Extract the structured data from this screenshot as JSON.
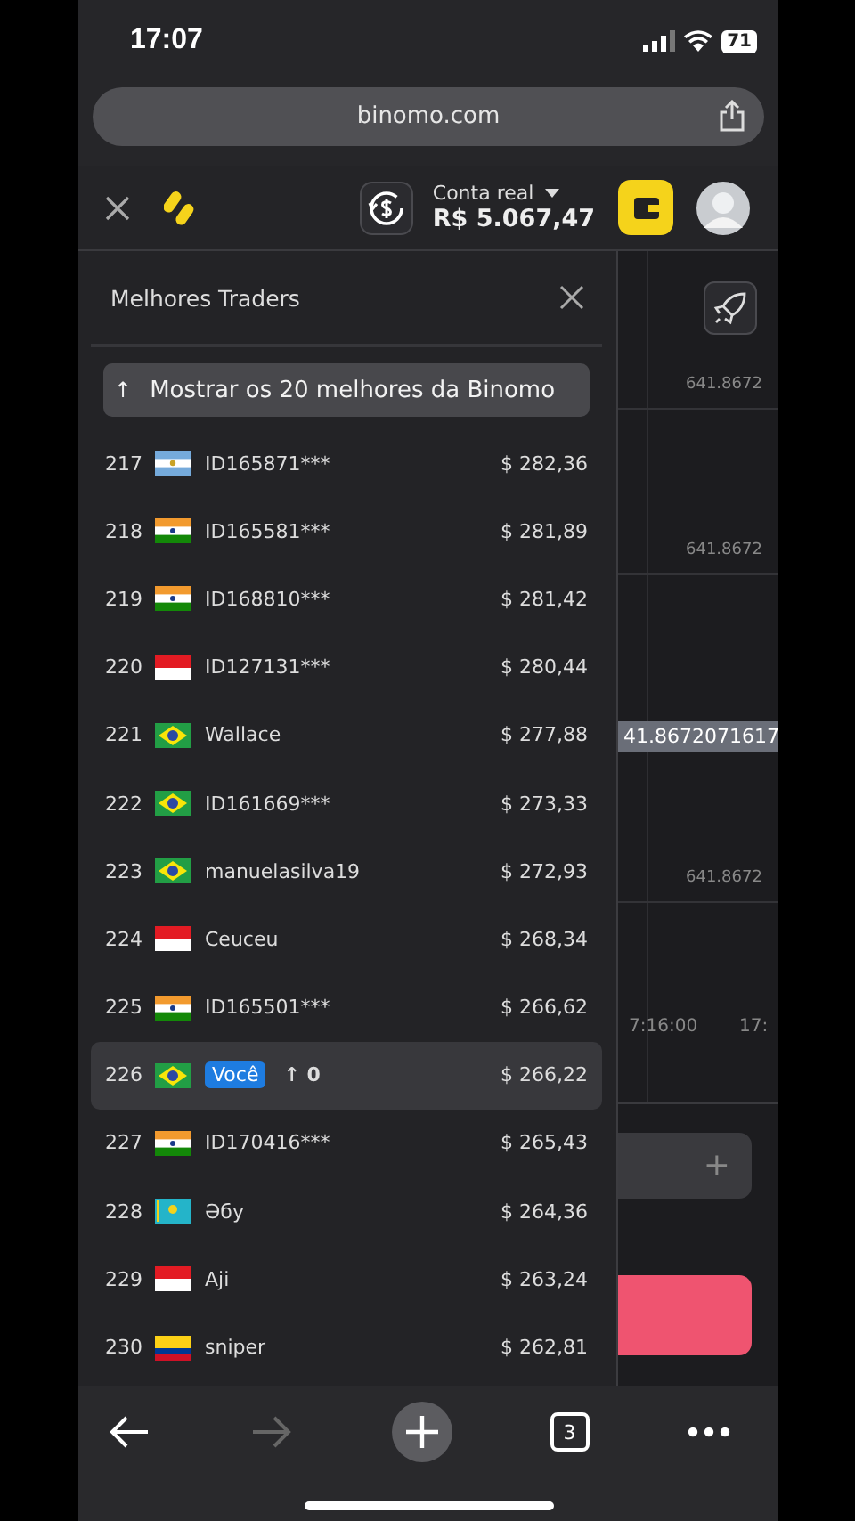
{
  "status_bar": {
    "time": "17:07",
    "battery": "71"
  },
  "browser": {
    "url": "binomo.com",
    "tab_count": "3",
    "forward_disabled": true
  },
  "header": {
    "account_label": "Conta real",
    "balance": "R$ 5.067,47"
  },
  "leaderboard": {
    "title": "Melhores Traders",
    "show_top_button": {
      "icon": "↑",
      "label": "Mostrar os 20 melhores da Binomo"
    },
    "rows": [
      {
        "rank": "217",
        "flag": {
          "kind": "ar"
        },
        "name": "ID165871***",
        "amount": "$ 282,36",
        "kind": "trader",
        "highlighted": false
      },
      {
        "rank": "218",
        "flag": {
          "kind": "in"
        },
        "name": "ID165581***",
        "amount": "$ 281,89",
        "kind": "trader",
        "highlighted": false
      },
      {
        "rank": "219",
        "flag": {
          "kind": "in"
        },
        "name": "ID168810***",
        "amount": "$ 281,42",
        "kind": "trader",
        "highlighted": false
      },
      {
        "rank": "220",
        "flag": {
          "kind": "id"
        },
        "name": "ID127131***",
        "amount": "$ 280,44",
        "kind": "trader",
        "highlighted": false
      },
      {
        "rank": "221",
        "flag": {
          "kind": "br"
        },
        "name": "Wallace",
        "amount": "$ 277,88",
        "kind": "trader",
        "highlighted": false
      },
      {
        "rank": "222",
        "flag": {
          "kind": "br"
        },
        "name": "ID161669***",
        "amount": "$ 273,33",
        "kind": "trader",
        "highlighted": false
      },
      {
        "rank": "223",
        "flag": {
          "kind": "br"
        },
        "name": "manuelasilva19",
        "amount": "$ 272,93",
        "kind": "trader",
        "highlighted": false
      },
      {
        "rank": "224",
        "flag": {
          "kind": "id"
        },
        "name": "Ceuceu",
        "amount": "$ 268,34",
        "kind": "trader",
        "highlighted": false
      },
      {
        "rank": "225",
        "flag": {
          "kind": "in"
        },
        "name": "ID165501***",
        "amount": "$ 266,62",
        "kind": "trader",
        "highlighted": false
      },
      {
        "rank": "226",
        "flag": {
          "kind": "br"
        },
        "name": "Você",
        "change": "↑ 0",
        "amount": "$ 266,22",
        "kind": "you",
        "highlighted": true
      },
      {
        "rank": "227",
        "flag": {
          "kind": "in"
        },
        "name": "ID170416***",
        "amount": "$ 265,43",
        "kind": "trader",
        "highlighted": false
      },
      {
        "rank": "228",
        "flag": {
          "kind": "kz"
        },
        "name": "Әбу",
        "amount": "$ 264,36",
        "kind": "trader",
        "highlighted": false
      },
      {
        "rank": "229",
        "flag": {
          "kind": "id"
        },
        "name": "Aji",
        "amount": "$ 263,24",
        "kind": "trader",
        "highlighted": false
      },
      {
        "rank": "230",
        "flag": {
          "kind": "co"
        },
        "name": "sniper",
        "amount": "$ 262,81",
        "kind": "trader",
        "highlighted": false
      }
    ]
  },
  "chart": {
    "price_labels": [
      "641.8672",
      "641.8672",
      "641.8672"
    ],
    "current_price": "41.8672071617",
    "time_labels": [
      "7:16:00",
      "17:"
    ]
  },
  "trade": {
    "amount_plus": "+"
  }
}
